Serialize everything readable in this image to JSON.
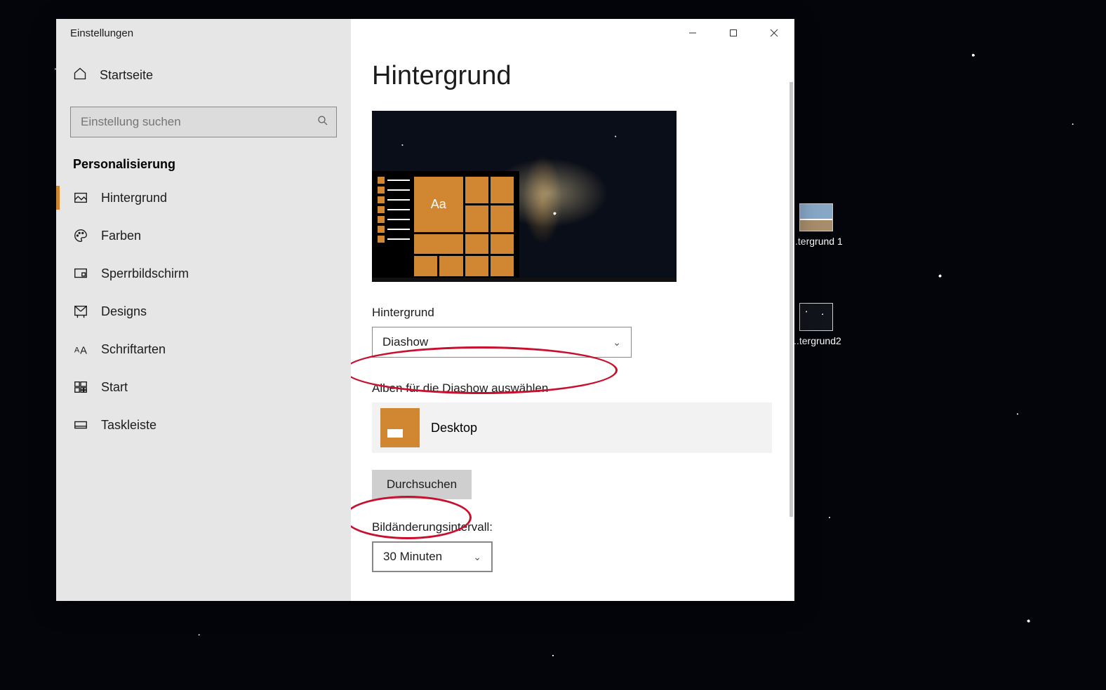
{
  "window": {
    "title": "Einstellungen",
    "controls": {
      "minimize": "–",
      "maximize": "▢",
      "close": "✕"
    }
  },
  "sidebar": {
    "home_label": "Startseite",
    "search_placeholder": "Einstellung suchen",
    "section_header": "Personalisierung",
    "items": [
      {
        "id": "background",
        "label": "Hintergrund",
        "active": true
      },
      {
        "id": "colors",
        "label": "Farben"
      },
      {
        "id": "lockscreen",
        "label": "Sperrbildschirm"
      },
      {
        "id": "themes",
        "label": "Designs"
      },
      {
        "id": "fonts",
        "label": "Schriftarten"
      },
      {
        "id": "start",
        "label": "Start"
      },
      {
        "id": "taskbar",
        "label": "Taskleiste"
      }
    ]
  },
  "main": {
    "page_title": "Hintergrund",
    "preview_sample_text": "Aa",
    "background_label": "Hintergrund",
    "background_value": "Diashow",
    "album_label": "Alben für die Diashow auswählen",
    "album_selected": "Desktop",
    "browse_label": "Durchsuchen",
    "interval_label": "Bildänderungsintervall:",
    "interval_value": "30 Minuten"
  },
  "desktop_icons": [
    {
      "label": "...tergrund 1"
    },
    {
      "label": "...tergrund2"
    }
  ],
  "accent_color": "#d18732"
}
